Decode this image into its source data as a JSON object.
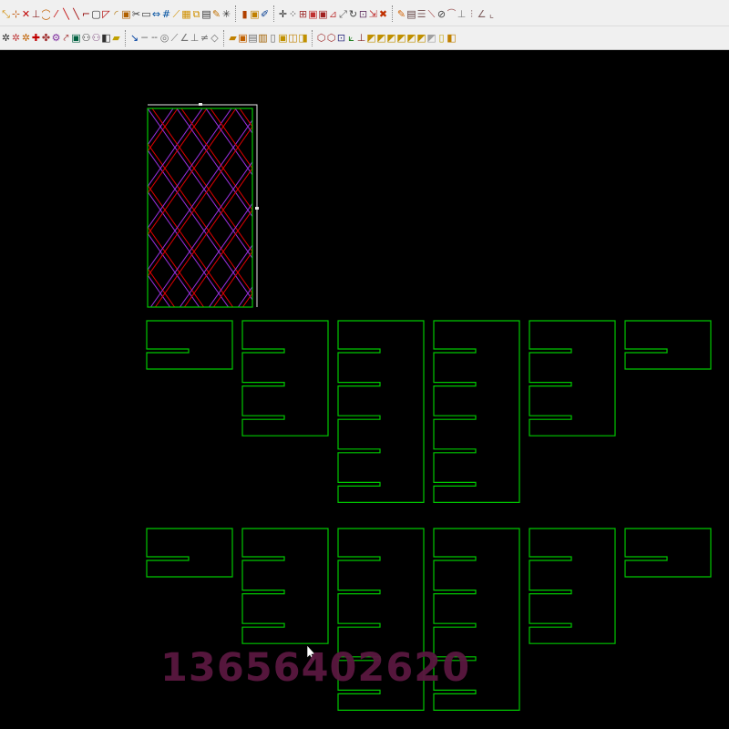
{
  "toolbar": {
    "row1": [
      {
        "name": "snap-endpoint-icon",
        "glyph": "⤡",
        "color": "#d08a00"
      },
      {
        "name": "snap-midpoint-icon",
        "glyph": "⊹",
        "color": "#c05000"
      },
      {
        "name": "snap-intersection-icon",
        "glyph": "✕",
        "color": "#c00000"
      },
      {
        "name": "snap-perpendicular-icon",
        "glyph": "⊥",
        "color": "#8a2020"
      },
      {
        "name": "snap-tangent-icon",
        "glyph": "◯",
        "color": "#c06000"
      },
      {
        "name": "snap-nearest-icon",
        "glyph": "⁄",
        "color": "#c00000"
      },
      {
        "name": "line-icon",
        "glyph": "╲",
        "color": "#c00000"
      },
      {
        "name": "line-angle-icon",
        "glyph": "╲",
        "color": "#a00000"
      },
      {
        "name": "polyline-icon",
        "glyph": "⌐",
        "color": "#900000"
      },
      {
        "name": "rectangle-icon",
        "glyph": "▢",
        "color": "#333333"
      },
      {
        "name": "chamfer-icon",
        "glyph": "◸",
        "color": "#b00000"
      },
      {
        "name": "fillet-icon",
        "glyph": "◜",
        "color": "#b07000"
      },
      {
        "name": "offset-icon",
        "glyph": "▣",
        "color": "#b06000"
      },
      {
        "name": "trim-icon",
        "glyph": "✂",
        "color": "#333333"
      },
      {
        "name": "text-icon",
        "glyph": "▭",
        "color": "#333333"
      },
      {
        "name": "dimension-icon",
        "glyph": "⇔",
        "color": "#0050a0"
      },
      {
        "name": "numbering-icon",
        "glyph": "#",
        "color": "#0050a0"
      },
      {
        "name": "measure-icon",
        "glyph": "⟋",
        "color": "#d09000"
      },
      {
        "name": "pattern-icon",
        "glyph": "▦",
        "color": "#d09000"
      },
      {
        "name": "copy-icon",
        "glyph": "⧉",
        "color": "#d09000"
      },
      {
        "name": "array-icon",
        "glyph": "▤",
        "color": "#333333"
      },
      {
        "name": "hatch-icon",
        "glyph": "✎",
        "color": "#c07000"
      },
      {
        "name": "explode-icon",
        "glyph": "✳",
        "color": "#333333"
      },
      {
        "name": "sep",
        "glyph": ""
      },
      {
        "name": "open-file-icon",
        "glyph": "▮",
        "color": "#b04000"
      },
      {
        "name": "save-file-icon",
        "glyph": "▣",
        "color": "#c08000"
      },
      {
        "name": "edit-icon",
        "glyph": "✐",
        "color": "#003a90"
      },
      {
        "name": "sep",
        "glyph": ""
      },
      {
        "name": "move-icon",
        "glyph": "✛",
        "color": "#202020"
      },
      {
        "name": "grid-icon",
        "glyph": "⁘",
        "color": "#303030"
      },
      {
        "name": "layer-icon",
        "glyph": "⊞",
        "color": "#a03030"
      },
      {
        "name": "rotate-icon",
        "glyph": "▣",
        "color": "#c03030"
      },
      {
        "name": "mirror-icon",
        "glyph": "▣",
        "color": "#a02020"
      },
      {
        "name": "scale-icon",
        "glyph": "⊿",
        "color": "#c04040"
      },
      {
        "name": "stretch-icon",
        "glyph": "⤢",
        "color": "#606060"
      },
      {
        "name": "refresh-icon",
        "glyph": "↻",
        "color": "#404040"
      },
      {
        "name": "properties-icon",
        "glyph": "⊡",
        "color": "#603060"
      },
      {
        "name": "send-icon",
        "glyph": "⇲",
        "color": "#c03030"
      },
      {
        "name": "delete-icon",
        "glyph": "✖",
        "color": "#c03000"
      },
      {
        "name": "sep",
        "glyph": ""
      },
      {
        "name": "pen-icon",
        "glyph": "✎",
        "color": "#d06000"
      },
      {
        "name": "ruler-icon",
        "glyph": "▤",
        "color": "#604040"
      },
      {
        "name": "list-icon",
        "glyph": "☰",
        "color": "#806060"
      },
      {
        "name": "diagonal-icon",
        "glyph": "⟍",
        "color": "#a04040"
      },
      {
        "name": "circle-tool-icon",
        "glyph": "⊘",
        "color": "#404040"
      },
      {
        "name": "arc-icon",
        "glyph": "⌒",
        "color": "#a06060"
      },
      {
        "name": "baseline-icon",
        "glyph": "⊥",
        "color": "#808080"
      },
      {
        "name": "chart-tool-icon",
        "glyph": "⫶",
        "color": "#806060"
      },
      {
        "name": "angle-icon",
        "glyph": "∠",
        "color": "#806060"
      },
      {
        "name": "corner-icon",
        "glyph": "⌞",
        "color": "#806060"
      }
    ],
    "row2": [
      {
        "name": "node-edit-icon",
        "glyph": "✲",
        "color": "#303030"
      },
      {
        "name": "node-add-icon",
        "glyph": "✲",
        "color": "#c04040"
      },
      {
        "name": "node-delete-icon",
        "glyph": "✲",
        "color": "#c06000"
      },
      {
        "name": "node-move-icon",
        "glyph": "✚",
        "color": "#c00000"
      },
      {
        "name": "node-break-icon",
        "glyph": "✤",
        "color": "#a03030"
      },
      {
        "name": "join-icon",
        "glyph": "⚙",
        "color": "#8030a0"
      },
      {
        "name": "spline-icon",
        "glyph": "⤤",
        "color": "#a03030"
      },
      {
        "name": "image-icon",
        "glyph": "▣",
        "color": "#006040"
      },
      {
        "name": "symbol-icon",
        "glyph": "⚇",
        "color": "#303030"
      },
      {
        "name": "grade-icon",
        "glyph": "⚇",
        "color": "#805080"
      },
      {
        "name": "block-icon",
        "glyph": "◧",
        "color": "#303030"
      },
      {
        "name": "fill-icon",
        "glyph": "▰",
        "color": "#c0a000"
      },
      {
        "name": "sep",
        "glyph": ""
      },
      {
        "name": "cursor-icon",
        "glyph": "↘",
        "color": "#0040a0"
      },
      {
        "name": "line-style-icon",
        "glyph": "─",
        "color": "#707070"
      },
      {
        "name": "dash-icon",
        "glyph": "╌",
        "color": "#707070"
      },
      {
        "name": "center-icon",
        "glyph": "◎",
        "color": "#707070"
      },
      {
        "name": "cross-line-icon",
        "glyph": "⟋",
        "color": "#707070"
      },
      {
        "name": "angle-line-icon",
        "glyph": "∠",
        "color": "#707070"
      },
      {
        "name": "perp-line-icon",
        "glyph": "⊥",
        "color": "#707070"
      },
      {
        "name": "not-equal-icon",
        "glyph": "≠",
        "color": "#707070"
      },
      {
        "name": "diamond-icon",
        "glyph": "◇",
        "color": "#707070"
      },
      {
        "name": "sep",
        "glyph": ""
      },
      {
        "name": "folder-open-icon",
        "glyph": "▰",
        "color": "#c08000"
      },
      {
        "name": "template-icon",
        "glyph": "▣",
        "color": "#c06000"
      },
      {
        "name": "calc-icon",
        "glyph": "▤",
        "color": "#707070"
      },
      {
        "name": "notes-icon",
        "glyph": "▥",
        "color": "#a06000"
      },
      {
        "name": "clipboard-icon",
        "glyph": "▯",
        "color": "#606060"
      },
      {
        "name": "paste-icon",
        "glyph": "▣",
        "color": "#c09000"
      },
      {
        "name": "layers-icon",
        "glyph": "◫",
        "color": "#c08000"
      },
      {
        "name": "stack-icon",
        "glyph": "◨",
        "color": "#c09000"
      },
      {
        "name": "sep",
        "glyph": ""
      },
      {
        "name": "view-3d-icon",
        "glyph": "⬡",
        "color": "#a03030"
      },
      {
        "name": "view-top-icon",
        "glyph": "⬡",
        "color": "#a03030"
      },
      {
        "name": "view-front-icon",
        "glyph": "⊡",
        "color": "#303080"
      },
      {
        "name": "axis-icon",
        "glyph": "⟀",
        "color": "#208020"
      },
      {
        "name": "ucs-icon",
        "glyph": "⊥",
        "color": "#802020"
      },
      {
        "name": "box-1-icon",
        "glyph": "◩",
        "color": "#c09000"
      },
      {
        "name": "box-2-icon",
        "glyph": "◩",
        "color": "#c09000"
      },
      {
        "name": "box-3-icon",
        "glyph": "◩",
        "color": "#c09000"
      },
      {
        "name": "box-4-icon",
        "glyph": "◩",
        "color": "#c09000"
      },
      {
        "name": "box-5-icon",
        "glyph": "◩",
        "color": "#c09000"
      },
      {
        "name": "box-6-icon",
        "glyph": "◩",
        "color": "#c09000"
      },
      {
        "name": "box-7-icon",
        "glyph": "◩",
        "color": "#a0a0a0"
      },
      {
        "name": "box-8-icon",
        "glyph": "▯",
        "color": "#c0a000"
      },
      {
        "name": "box-9-icon",
        "glyph": "◧",
        "color": "#c08000"
      }
    ]
  },
  "drawing": {
    "shape_color": "#00c800",
    "pattern_red": "#e00000",
    "pattern_purple": "#9a30e0",
    "frame_color": "#e8e8e8"
  },
  "watermark": {
    "text": "13656402620",
    "color": "#5a1840"
  }
}
